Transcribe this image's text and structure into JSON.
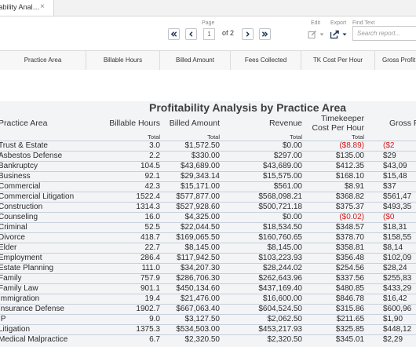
{
  "tab": {
    "label": "itability Anal…",
    "close": "×"
  },
  "toolbar": {
    "page_caption": "Page",
    "page_value": "1",
    "page_of": "of 2",
    "edit_caption": "Edit",
    "export_caption": "Export",
    "find_caption": "Find Text",
    "search_placeholder": "Search report..."
  },
  "columns": [
    "Practice Area",
    "Billable Hours",
    "Billed Amount",
    "Fees Collected",
    "TK Cost Per Hour",
    "Gross Profit"
  ],
  "report": {
    "title": "Profitability Analysis by Practice Area",
    "headers": {
      "practice_area": "Practice Area",
      "billable_hours": "Billable Hours",
      "billed_amount": "Billed Amount",
      "revenue": "Revenue",
      "tk_cost_line1": "Timekeeper",
      "tk_cost_line2": "Cost Per Hour",
      "gross": "Gross P"
    },
    "total_label": "Total",
    "rows": [
      {
        "area": "Trust & Estate",
        "hours": "3.0",
        "billed": "$1,572.50",
        "revenue": "$0.00",
        "tk_cost": "($8.89)",
        "gross": "($2",
        "neg_tk": true,
        "neg_gross": true
      },
      {
        "area": "Asbestos Defense",
        "hours": "2.2",
        "billed": "$330.00",
        "revenue": "$297.00",
        "tk_cost": "$135.00",
        "gross": "$29",
        "neg_tk": false,
        "neg_gross": false
      },
      {
        "area": "Bankruptcy",
        "hours": "104.5",
        "billed": "$43,689.00",
        "revenue": "$43,689.00",
        "tk_cost": "$412.35",
        "gross": "$43,09",
        "neg_tk": false,
        "neg_gross": false
      },
      {
        "area": "Business",
        "hours": "92.1",
        "billed": "$29,343.14",
        "revenue": "$15,575.00",
        "tk_cost": "$168.10",
        "gross": "$15,48",
        "neg_tk": false,
        "neg_gross": false
      },
      {
        "area": "Commercial",
        "hours": "42.3",
        "billed": "$15,171.00",
        "revenue": "$561.00",
        "tk_cost": "$8.91",
        "gross": "$37",
        "neg_tk": false,
        "neg_gross": false
      },
      {
        "area": "Commercial Litigation",
        "hours": "1522.4",
        "billed": "$577,877.00",
        "revenue": "$568,098.21",
        "tk_cost": "$368.82",
        "gross": "$561,47",
        "neg_tk": false,
        "neg_gross": false
      },
      {
        "area": "Construction",
        "hours": "1314.3",
        "billed": "$527,928.60",
        "revenue": "$500,721.18",
        "tk_cost": "$375.37",
        "gross": "$493,35",
        "neg_tk": false,
        "neg_gross": false
      },
      {
        "area": "Counseling",
        "hours": "16.0",
        "billed": "$4,325.00",
        "revenue": "$0.00",
        "tk_cost": "($0.02)",
        "gross": "($0",
        "neg_tk": true,
        "neg_gross": true
      },
      {
        "area": "Criminal",
        "hours": "52.5",
        "billed": "$22,044.50",
        "revenue": "$18,534.50",
        "tk_cost": "$348.57",
        "gross": "$18,31",
        "neg_tk": false,
        "neg_gross": false
      },
      {
        "area": "Divorce",
        "hours": "418.7",
        "billed": "$169,065.50",
        "revenue": "$160,760.65",
        "tk_cost": "$378.70",
        "gross": "$158,55",
        "neg_tk": false,
        "neg_gross": false
      },
      {
        "area": "Elder",
        "hours": "22.7",
        "billed": "$8,145.00",
        "revenue": "$8,145.00",
        "tk_cost": "$358.81",
        "gross": "$8,14",
        "neg_tk": false,
        "neg_gross": false
      },
      {
        "area": "Employment",
        "hours": "286.4",
        "billed": "$117,942.50",
        "revenue": "$103,223.93",
        "tk_cost": "$356.48",
        "gross": "$102,09",
        "neg_tk": false,
        "neg_gross": false
      },
      {
        "area": "Estate Planning",
        "hours": "111.0",
        "billed": "$34,207.30",
        "revenue": "$28,244.02",
        "tk_cost": "$254.56",
        "gross": "$28,24",
        "neg_tk": false,
        "neg_gross": false
      },
      {
        "area": "Family",
        "hours": "757.9",
        "billed": "$286,706.30",
        "revenue": "$262,643.96",
        "tk_cost": "$337.56",
        "gross": "$255,83",
        "neg_tk": false,
        "neg_gross": false
      },
      {
        "area": "Family Law",
        "hours": "901.1",
        "billed": "$450,134.60",
        "revenue": "$437,169.40",
        "tk_cost": "$480.85",
        "gross": "$433,29",
        "neg_tk": false,
        "neg_gross": false
      },
      {
        "area": "Immigration",
        "hours": "19.4",
        "billed": "$21,476.00",
        "revenue": "$16,600.00",
        "tk_cost": "$846.78",
        "gross": "$16,42",
        "neg_tk": false,
        "neg_gross": false
      },
      {
        "area": "Insurance Defense",
        "hours": "1902.7",
        "billed": "$667,063.40",
        "revenue": "$604,524.50",
        "tk_cost": "$315.86",
        "gross": "$600,96",
        "neg_tk": false,
        "neg_gross": false
      },
      {
        "area": "IP",
        "hours": "9.0",
        "billed": "$3,127.50",
        "revenue": "$2,062.50",
        "tk_cost": "$211.65",
        "gross": "$1,90",
        "neg_tk": false,
        "neg_gross": false
      },
      {
        "area": "Litigation",
        "hours": "1375.3",
        "billed": "$534,503.00",
        "revenue": "$453,217.93",
        "tk_cost": "$325.85",
        "gross": "$448,12",
        "neg_tk": false,
        "neg_gross": false
      },
      {
        "area": "Medical Malpractice",
        "hours": "6.7",
        "billed": "$2,320.50",
        "revenue": "$2,320.50",
        "tk_cost": "$345.01",
        "gross": "$2,29",
        "neg_tk": false,
        "neg_gross": false
      }
    ]
  }
}
